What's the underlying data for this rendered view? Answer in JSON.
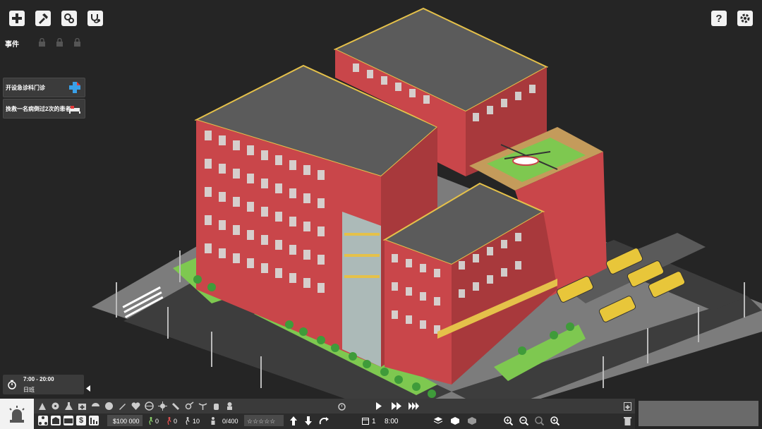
{
  "toolbar": {
    "buttons": [
      "build-icon",
      "hammer-icon",
      "gears-icon",
      "stethoscope-icon"
    ]
  },
  "top_right": {
    "help": "?",
    "settings": "gear"
  },
  "events": {
    "label": "事件",
    "locked_slots": 3
  },
  "objectives": [
    {
      "label": "开设急诊科门诊",
      "icon": "medical-cross-icon"
    },
    {
      "label": "挽救一名病倒过2次的患者",
      "icon": "patient-bed-icon"
    }
  ],
  "shift": {
    "time": "7:00 - 20:00",
    "name": "日班"
  },
  "status": {
    "money": "$100 000",
    "patients_walking": "0",
    "patients_red": "0",
    "staff": "10",
    "capacity": "0/400",
    "rating": "☆☆☆☆☆",
    "day": "1",
    "clock": "8:00"
  },
  "colors": {
    "brick": "#c9464a",
    "roof": "#5b5b5b",
    "trim": "#e5c14a",
    "ground": "#7b7b7b",
    "road": "#3f3f3f",
    "grass": "#7ec850"
  }
}
